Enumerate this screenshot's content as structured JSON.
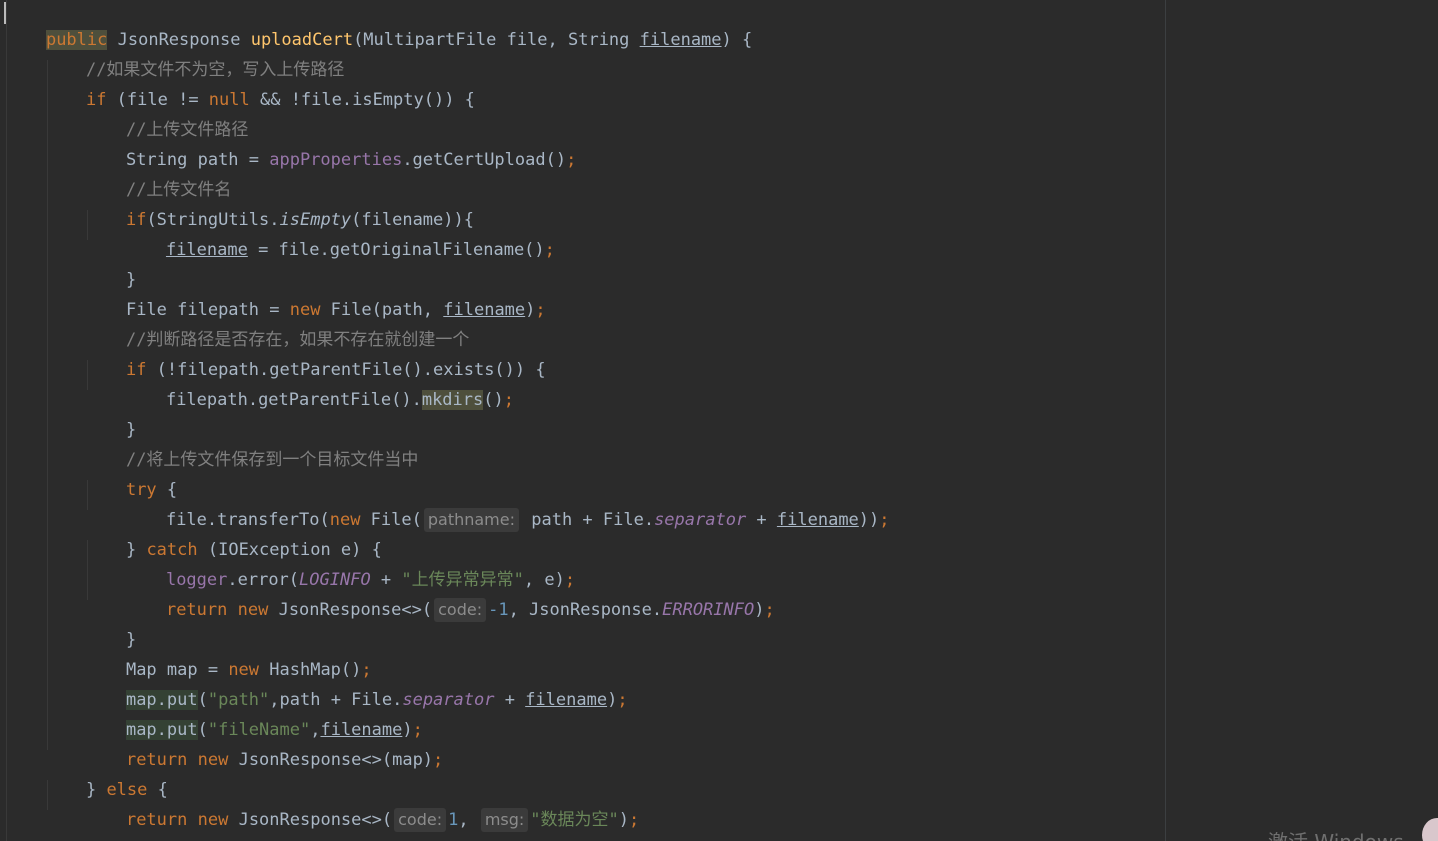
{
  "code": {
    "sig_public": "public",
    "sig_return": "JsonResponse",
    "sig_method": "uploadCert",
    "sig_params_open": "(MultipartFile file, String ",
    "sig_filename": "filename",
    "sig_params_close": ") {",
    "c_not_empty": "//如果文件不为空，写入上传路径",
    "if_kw": "if",
    "if_check": " (file != ",
    "null_kw": "null",
    "if_check_rest": " && !file.isEmpty()) {",
    "c_upload_path": "//上传文件路径",
    "path_decl": "String path = ",
    "app_properties": "appProperties",
    "get_cert_upload": ".getCertUpload()",
    "semi": ";",
    "c_upload_name": "//上传文件名",
    "if_blank_open": "(StringUtils.",
    "is_empty": "isEmpty",
    "if_blank_close": "(filename)){",
    "filename": "filename",
    "orig_name_rest": " = file.getOriginalFilename()",
    "close_brace": "}",
    "filepath_decl": "File filepath = ",
    "new_kw": "new",
    "file_ctor": " File(path, ",
    "close_paren": ")",
    "c_check_dir": "//判断路径是否存在，如果不存在就创建一个",
    "exists_check": " (!filepath.getParentFile().exists()) {",
    "get_parent": "filepath.getParentFile().",
    "mkdirs": "mkdirs",
    "empty_call": "()",
    "c_save": "//将上传文件保存到一个目标文件当中",
    "try_kw": "try",
    "open_brace": " {",
    "transfer_open": "file.transferTo(",
    "file_open": " File(",
    "hint_pathname": "pathname:",
    "path_plus": " path + File.",
    "separator": "separator",
    "plus": " + ",
    "double_close": "))",
    "catch_close": "} ",
    "catch_kw": "catch",
    "catch_rest": " (IOException e) {",
    "logger": "logger",
    "error_call": ".error(",
    "loginfo": "LOGINFO",
    "err_msg": "\"上传异常异常\"",
    "e_arg": ", e)",
    "return_kw": "return",
    "json_diamond": " JsonResponse<>(",
    "hint_code": "code:",
    "neg_one": "-1",
    "errorinfo_prefix": ", JsonResponse.",
    "errorinfo": "ERRORINFO",
    "map_decl": "Map map = ",
    "hashmap": " HashMap()",
    "map_put": "map.put",
    "open_paren": "(",
    "path_str": "\"path\"",
    "comma_path": ",path + File.",
    "filename_str": "\"fileName\"",
    "comma": ",",
    "return_map": " JsonResponse<>(map)",
    "else_open": "} ",
    "else_kw": "else",
    "one": "1",
    "comma_sp": ", ",
    "hint_msg": "msg:",
    "empty_msg": "\"数据为空\""
  },
  "watermark": "激活 Windows",
  "colors": {
    "background": "#2b2b2b",
    "keyword": "#cc7832",
    "comment": "#808080",
    "method": "#ffc66d",
    "field": "#9876aa",
    "string": "#6a8759",
    "number": "#6897bb",
    "text": "#a9b7c6"
  }
}
